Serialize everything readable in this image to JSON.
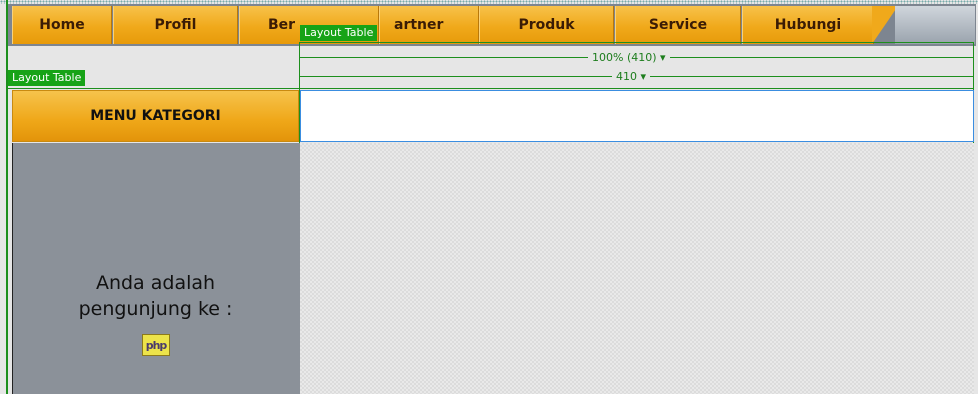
{
  "nav": {
    "tabs": [
      {
        "label": "Home"
      },
      {
        "label": "Profil"
      },
      {
        "label": "Ber"
      },
      {
        "label": "artner"
      },
      {
        "label": "Produk"
      },
      {
        "label": "Service"
      },
      {
        "label": "Hubungi"
      }
    ]
  },
  "layout": {
    "tag_top": "Layout Table",
    "tag_left": "Layout Table",
    "width_label_1": "100% (410) ▾",
    "width_label_2": "410 ▾"
  },
  "sidebar": {
    "menu_title": "MENU KATEGORI",
    "visitor_line1": "Anda adalah",
    "visitor_line2": "pengunjung ke :",
    "php_icon_text": "php"
  },
  "colors": {
    "tab_orange": "#f0a91b",
    "layout_green": "#17a317",
    "sidebar_gray": "#8b9199"
  }
}
